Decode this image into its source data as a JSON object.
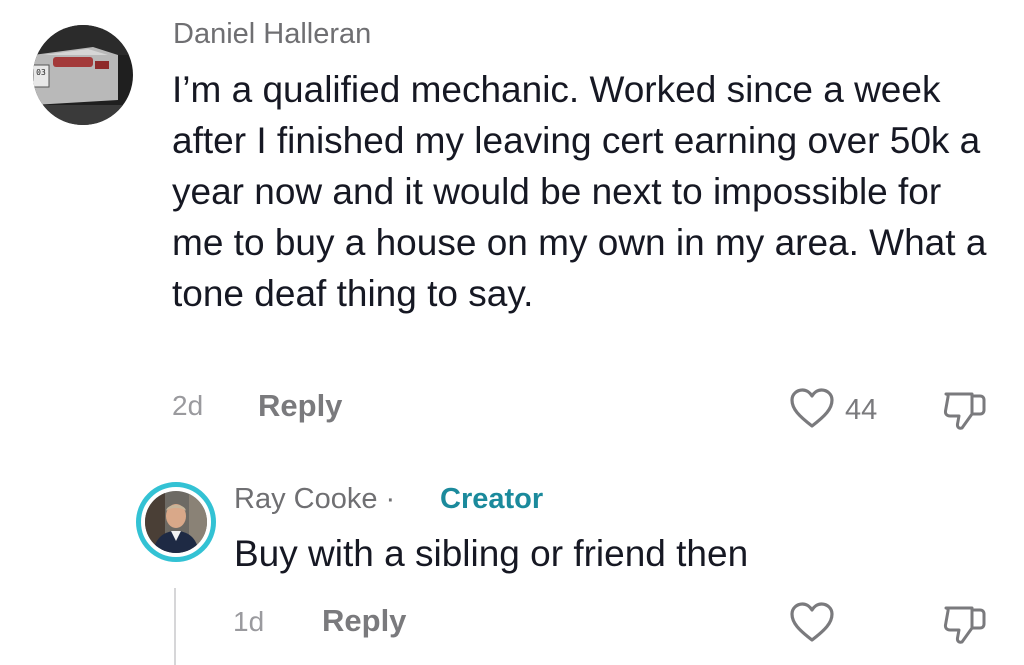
{
  "comment": {
    "username": "Daniel Halleran",
    "text": "I’m a qualified mechanic. Worked since a week after I finished my leaving cert earning over 50k a year now and it would be next to impossible for me to buy a house on my own in my area. What a tone deaf thing to say.",
    "time": "2d",
    "reply_label": "Reply",
    "like_count": "44",
    "avatar_plate": "03"
  },
  "reply": {
    "username": "Ray Cooke",
    "separator": " · ",
    "badge": "Creator",
    "text": "Buy with a sibling or friend then",
    "time": "1d",
    "reply_label": "Reply"
  },
  "icons": {
    "like": "heart-outline-icon",
    "dislike": "thumbs-down-icon"
  },
  "colors": {
    "creator_ring": "#33c2d4",
    "creator_badge": "#1b8a9c",
    "meta_text": "#7a7a7d"
  }
}
